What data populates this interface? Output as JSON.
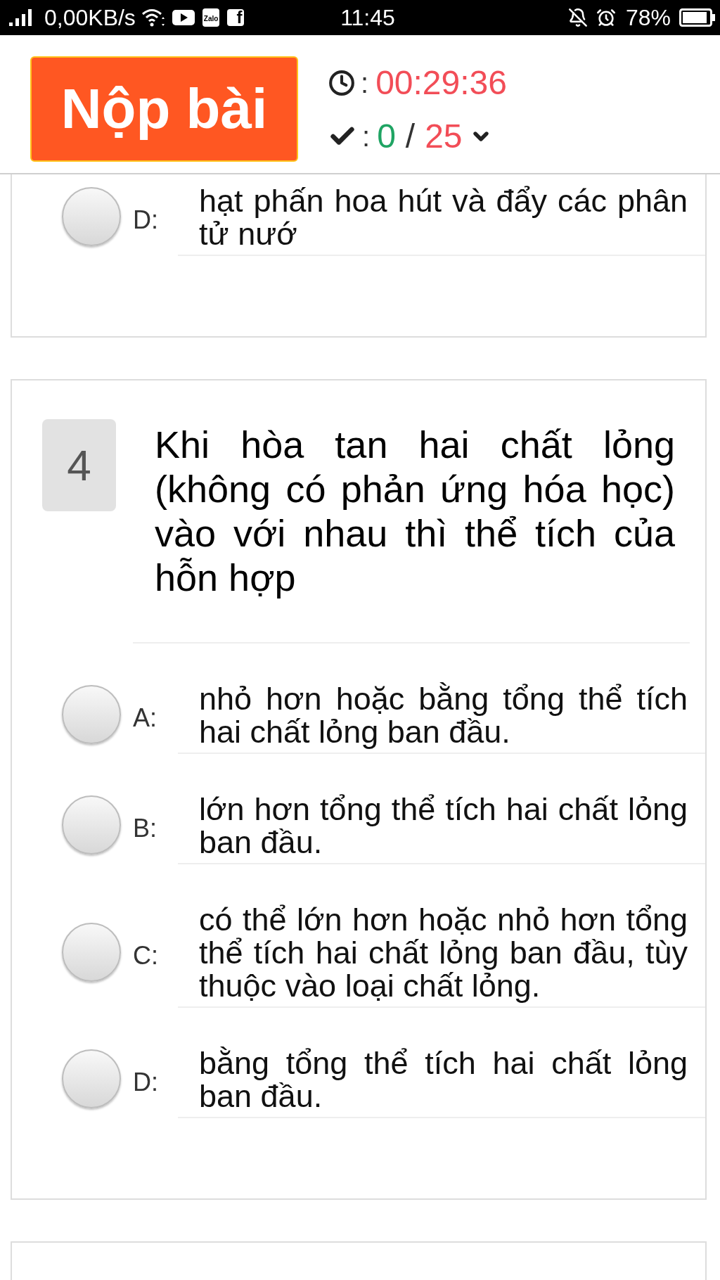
{
  "status_bar": {
    "network_speed": "0,00KB/s",
    "app_badges": [
      "Zalo",
      "f"
    ],
    "time": "11:45",
    "battery": "78%"
  },
  "header": {
    "submit_button": "Nộp bài",
    "timer": {
      "separator": ":",
      "value": "00:29:36"
    },
    "progress": {
      "separator": ":",
      "answered": "0",
      "slash": "/",
      "total": "25"
    }
  },
  "questions": [
    {
      "options": [
        {
          "label": "D:",
          "text": "hạt phấn hoa hút và đẩy các phân tử nướ",
          "selected": false
        }
      ]
    },
    {
      "number": "4",
      "text": "Khi hòa tan hai chất lỏng (không có phản ứng hóa học) vào với nhau thì thể tích của hỗn hợp",
      "options": [
        {
          "label": "A:",
          "text": "nhỏ hơn hoặc bằng tổng thể tích hai chất lỏng ban đầu.",
          "selected": false
        },
        {
          "label": "B:",
          "text": "lớn hơn tổng thể tích hai chất lỏng ban đầu.",
          "selected": false
        },
        {
          "label": "C:",
          "text": "có thể lớn hơn hoặc nhỏ hơn tổng thể tích hai chất lỏng ban đầu, tùy thuộc vào loại chất lỏng.",
          "selected": false
        },
        {
          "label": "D:",
          "text": "bằng tổng thể tích hai chất lỏng ban đầu.",
          "selected": false
        }
      ]
    }
  ]
}
